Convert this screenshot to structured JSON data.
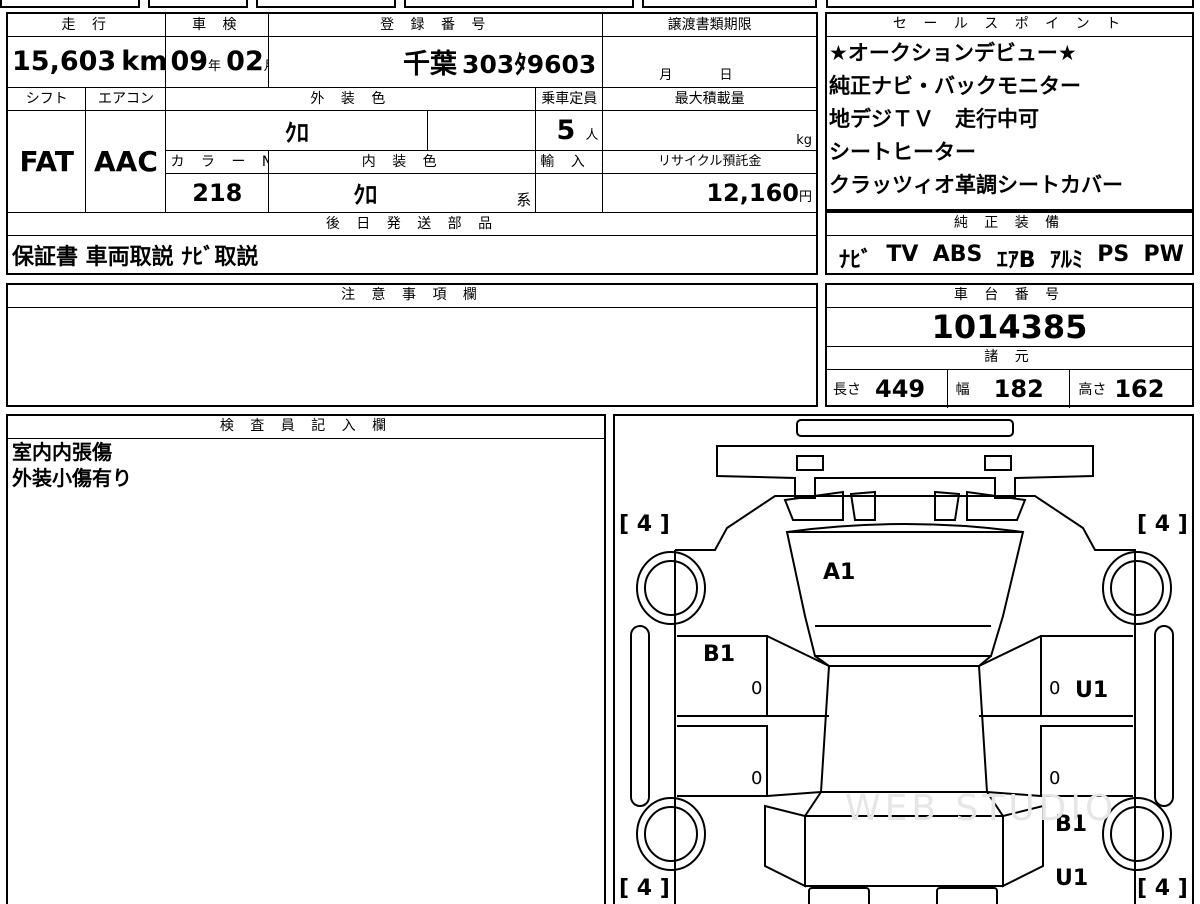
{
  "header": {
    "mileage_label": "走 行",
    "inspection_label": "車 検",
    "registration_label": "登 録 番 号",
    "transfer_deadline_label": "譲渡書類期限",
    "shift_label": "シフト",
    "aircon_label": "エアコン",
    "exterior_color_label": "外 装 色",
    "capacity_label": "乗車定員",
    "max_load_label": "最大積載量",
    "color_no_label": "カ ラ ー No.",
    "interior_color_label": "内 装 色",
    "import_label": "輸 入 車",
    "recycle_label": "リサイクル預託金",
    "later_parts_label": "後 日 発 送 部 品"
  },
  "vehicle": {
    "mileage": "15,603",
    "mileage_unit": "km",
    "inspection_year": "09",
    "inspection_year_unit": "年",
    "inspection_month": "02",
    "inspection_month_unit": "月",
    "reg_region": "千葉",
    "reg_class": "303",
    "reg_kana": "ﾀ",
    "reg_number": "9603",
    "deadline_month_unit": "月",
    "deadline_day_unit": "日",
    "shift": "FAT",
    "aircon": "AAC",
    "exterior_color": "ｸﾛ",
    "capacity": "5",
    "capacity_unit": "人",
    "max_load_unit": "kg",
    "color_no": "218",
    "interior_color": "ｸﾛ",
    "interior_color_suffix": "系",
    "recycle_fee": "12,160",
    "recycle_unit": "円",
    "later_parts": "保証書 車両取説 ﾅﾋﾞ取説"
  },
  "sales_points": {
    "label": "セ ー ル ス ポ イ ン ト",
    "lines": [
      "★オークションデビュー★",
      "純正ナビ・バックモニター",
      "地デジＴＶ　走行中可",
      "シートヒーター",
      "クラッツィオ革調シートカバー"
    ]
  },
  "equipment": {
    "label": "純 正 装 備",
    "items": [
      "ﾅﾋﾞ",
      "TV",
      "ABS",
      "ｴｱB",
      "ｱﾙﾐ",
      "PS",
      "PW"
    ]
  },
  "caution": {
    "label": "注 意 事 項 欄",
    "text": ""
  },
  "chassis": {
    "label": "車 台 番 号",
    "number": "1014385",
    "specs_label": "諸 元",
    "length_label": "長さ",
    "length": "449",
    "width_label": "幅",
    "width": "182",
    "height_label": "高さ",
    "height": "162"
  },
  "inspector": {
    "label": "検 査 員 記 入 欄",
    "lines": [
      "室内内張傷",
      "外装小傷有り"
    ]
  },
  "diagram": {
    "tire_brackets": [
      "4",
      "4",
      "4",
      "4"
    ],
    "marks": {
      "windshield": "A1",
      "left_front_door": "B1",
      "right_front_door": "U1",
      "right_rear": "B1",
      "right_rear_lower": "U1"
    },
    "zeros": [
      "0",
      "0",
      "0",
      "0"
    ],
    "watermark": "WEB STUDIO"
  }
}
